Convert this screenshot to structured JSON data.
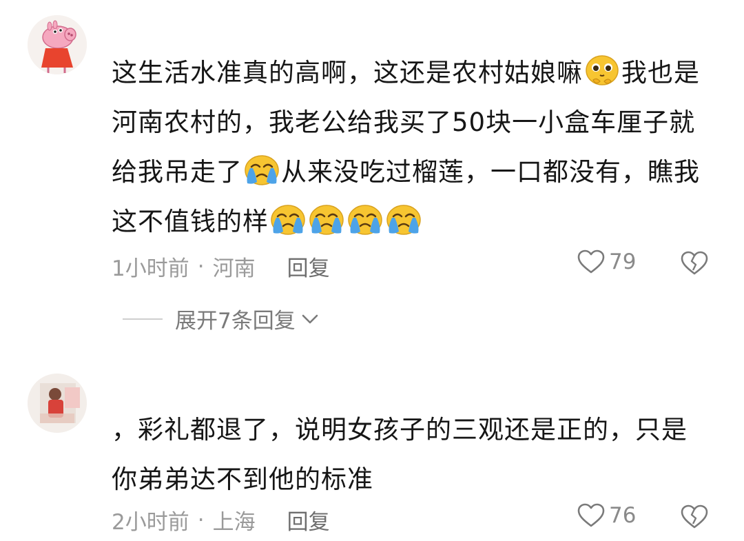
{
  "comments": [
    {
      "avatar_icon": "peppa-pig-avatar-icon",
      "text_parts": {
        "p1": "这生活水准真的高啊，这还是农村姑娘嘛",
        "p2": "我也是河南农村的，我老公给我买了50块一小盒车厘子就给我吊走了",
        "p3": "从来没吃过榴莲，一口都没有，瞧我这不值钱的样"
      },
      "time": "1小时前",
      "separator": "·",
      "location": "河南",
      "reply_label": "回复",
      "likes": "79",
      "expand_label": "展开7条回复"
    },
    {
      "avatar_icon": "photo-avatar-icon",
      "text": "，彩礼都退了，说明女孩子的三观还是正的，只是你弟弟达不到他的标准",
      "time": "2小时前",
      "separator": "·",
      "location": "上海",
      "reply_label": "回复",
      "likes": "76"
    }
  ],
  "colors": {
    "meta_gray": "#9a9a9a",
    "emoji_yellow": "#f7c531",
    "tear_blue": "#4da3e8"
  }
}
